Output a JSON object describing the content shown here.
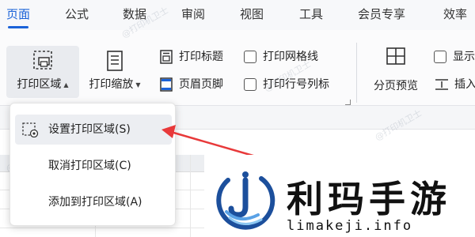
{
  "menu": {
    "tabs": [
      {
        "label": "页面",
        "active": true
      },
      {
        "label": "公式"
      },
      {
        "label": "数据"
      },
      {
        "label": "审阅"
      },
      {
        "label": "视图"
      },
      {
        "label": "工具"
      },
      {
        "label": "会员专享"
      },
      {
        "label": "效率"
      }
    ]
  },
  "ribbon": {
    "print_area": {
      "label": "打印区域",
      "icon": "print-area-icon"
    },
    "print_scale": {
      "label": "打印缩放",
      "icon": "print-scale-icon"
    },
    "print_title": {
      "label": "打印标题",
      "icon": "print-title-icon"
    },
    "header_footer": {
      "label": "页眉页脚",
      "icon": "header-footer-icon"
    },
    "print_gridlines": {
      "label": "打印网格线",
      "checked": false
    },
    "print_row_col_headers": {
      "label": "打印行号列标",
      "checked": false
    },
    "page_break_preview": {
      "label": "分页预览",
      "icon": "page-break-preview-icon"
    },
    "show": {
      "label": "显示",
      "checked": false
    },
    "insert": {
      "label": "插入",
      "icon": "insert-icon"
    }
  },
  "dropdown": {
    "items": [
      {
        "label": "设置打印区域(S)",
        "icon": "set-print-area-icon",
        "highlighted": true
      },
      {
        "label": "取消打印区域(C)"
      },
      {
        "label": "添加到打印区域(A)"
      }
    ]
  },
  "watermark": "@打印机卫士",
  "logo": {
    "name_cn": "利玛手游",
    "domain": "limakeji.info"
  },
  "colors": {
    "accent": "#1a62d8",
    "arrow": "#e8393a"
  }
}
